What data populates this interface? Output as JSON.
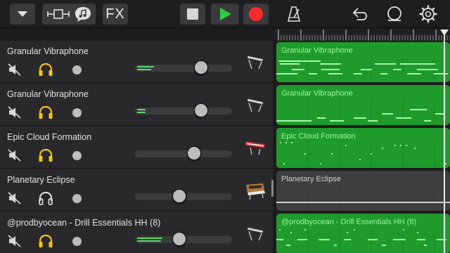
{
  "toolbar": {
    "fx_label": "FX",
    "accent_play": "#2ecc40",
    "accent_record": "#ff2a2a",
    "icons": [
      "dropdown-arrow-icon",
      "track-view-icon",
      "smart-controls-icon",
      "stop-icon",
      "play-icon",
      "record-icon",
      "metronome-icon",
      "undo-icon",
      "loop-icon",
      "settings-gear-icon"
    ]
  },
  "tracks": [
    {
      "name": "Granular Vibraphone",
      "region_label": "Granular Vibraphone",
      "headphones_active": true,
      "volume": 0.68,
      "meter_level": "high",
      "instrument_icon": "keyboard-icon",
      "region_color": "green"
    },
    {
      "name": "Granular Vibraphone",
      "region_label": "Granular Vibraphone",
      "headphones_active": true,
      "volume": 0.68,
      "meter_level": "low",
      "instrument_icon": "keyboard-icon",
      "region_color": "green"
    },
    {
      "name": "Epic Cloud Formation",
      "region_label": "Epic Cloud Formation",
      "headphones_active": true,
      "volume": 0.6,
      "meter_level": "none",
      "instrument_icon": "red-synth-icon",
      "region_color": "green"
    },
    {
      "name": "Planetary Eclipse",
      "region_label": "Planetary Eclipse",
      "headphones_active": false,
      "volume": 0.46,
      "meter_level": "none",
      "instrument_icon": "analog-synth-icon",
      "region_color": "gray"
    },
    {
      "name": "@prodbyocean - Drill Essentials HH (8)",
      "region_label": "@prodbyocean - Drill Essentials HH (8)",
      "headphones_active": true,
      "volume": 0.46,
      "meter_level": "high",
      "instrument_icon": "keyboard-icon",
      "region_color": "green"
    }
  ]
}
